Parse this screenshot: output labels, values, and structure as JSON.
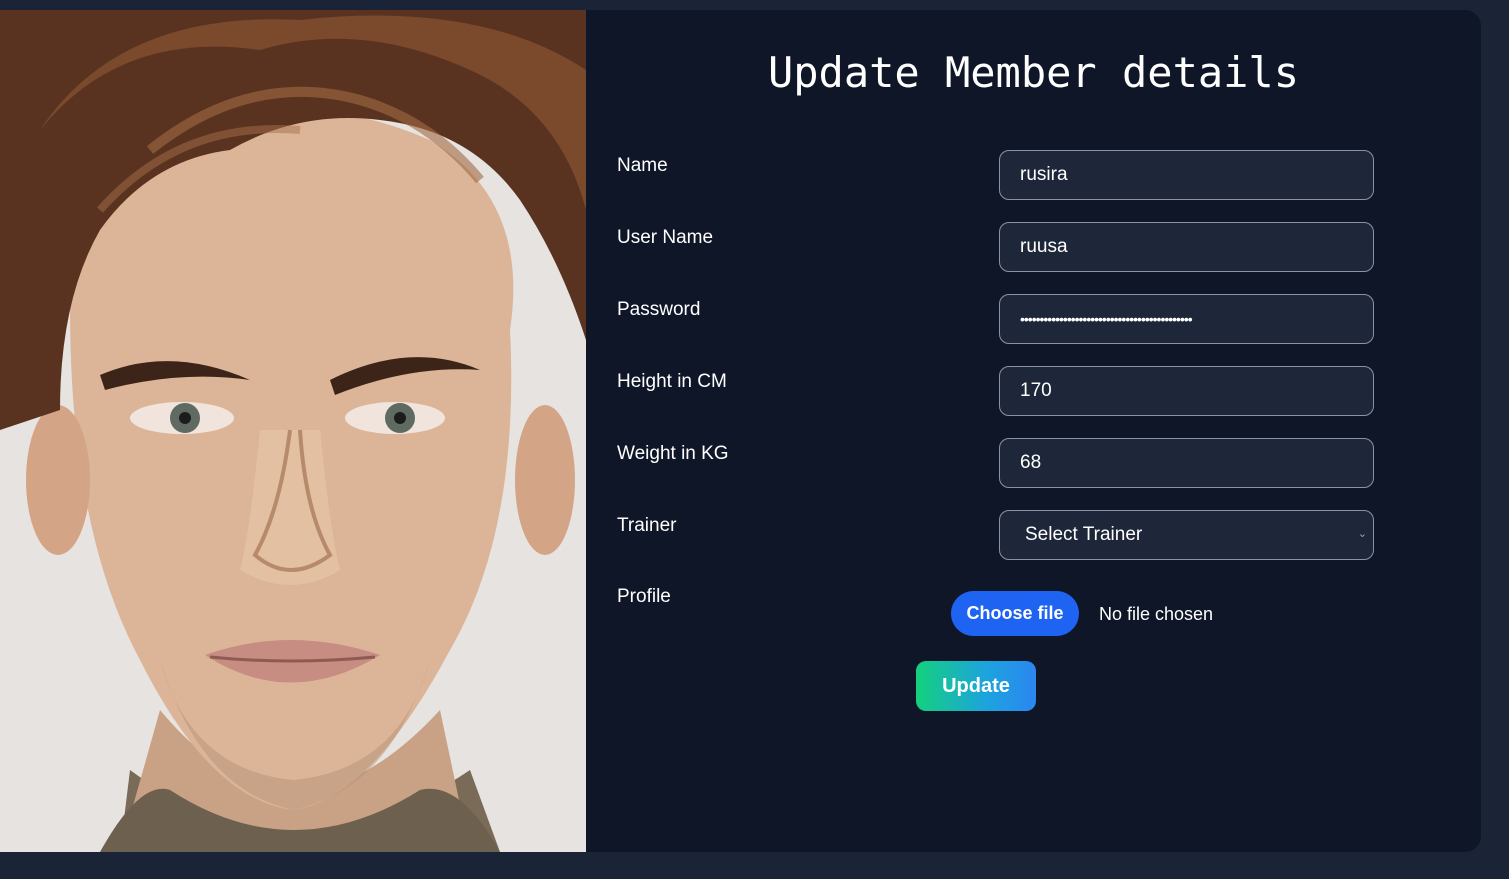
{
  "form": {
    "title": "Update Member details",
    "fields": [
      {
        "label": "Name",
        "value": "rusira"
      },
      {
        "label": "User Name",
        "value": "ruusa"
      },
      {
        "label": "Password",
        "value": "••••••••••••••••••••••••••••••••••••••••••••"
      },
      {
        "label": "Height in CM",
        "value": "170"
      },
      {
        "label": "Weight in KG",
        "value": "68"
      }
    ],
    "trainer": {
      "label": "Trainer",
      "selected": "Select Trainer"
    },
    "profile": {
      "label": "Profile",
      "button_label": "Choose file",
      "status": "No file chosen"
    },
    "submit_label": "Update"
  },
  "colors": {
    "page_bg": "#1b2436",
    "card_bg": "#0f1628",
    "input_bg": "#1e2739",
    "choose_button": "#1e63f2",
    "update_gradient_start": "#14d07e",
    "update_gradient_end": "#2b86f0"
  },
  "icons": {
    "select_chevron": "chevron-down-icon"
  }
}
